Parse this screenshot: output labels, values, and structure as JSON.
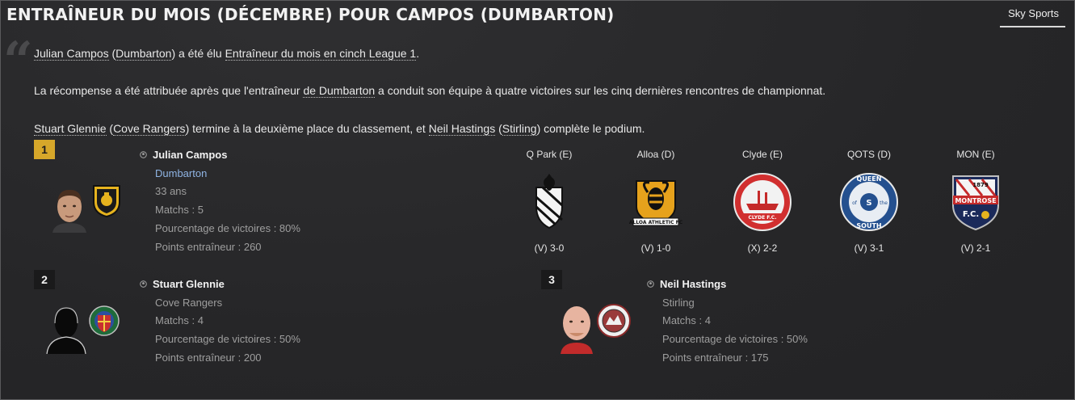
{
  "title": "ENTRAÎNEUR DU MOIS (DÉCEMBRE) POUR CAMPOS (DUMBARTON)",
  "source_tab": "Sky Sports",
  "paragraphs": {
    "p1": {
      "l1": "Julian Campos",
      "t1": " (",
      "l2": "Dumbarton",
      "t2": ") a été élu ",
      "l3": "Entraîneur du mois en cinch League 1",
      "t3": "."
    },
    "p2": {
      "t1": "La récompense a été attribuée après que l'entraîneur ",
      "l1": "de Dumbarton",
      "t2": " a conduit son équipe à quatre victoires sur les cinq dernières rencontres de championnat."
    },
    "p3": {
      "l1": "Stuart Glennie",
      "t1": " (",
      "l2": "Cove Rangers",
      "t2": ") termine à la deuxième place du classement, et ",
      "l3": "Neil Hastings",
      "t3": " (",
      "l4": "Stirling",
      "t4": ") complète le podium."
    }
  },
  "first": {
    "rank": "1",
    "name": "Julian Campos",
    "club": "Dumbarton",
    "age": "33 ans",
    "matches": "Matchs : 5",
    "win_pct": "Pourcentage de victoires : 80%",
    "points": "Points entraîneur : 260"
  },
  "second": {
    "rank": "2",
    "name": "Stuart Glennie",
    "club": "Cove Rangers",
    "matches": "Matchs : 4",
    "win_pct": "Pourcentage de victoires : 50%",
    "points": "Points entraîneur : 200"
  },
  "third": {
    "rank": "3",
    "name": "Neil Hastings",
    "club": "Stirling",
    "matches": "Matchs : 4",
    "win_pct": "Pourcentage de victoires : 50%",
    "points": "Points entraîneur : 175"
  },
  "matches": [
    {
      "opponent": "Q Park (E)",
      "result": "(V) 3-0",
      "badge": "queens-park-crest-icon"
    },
    {
      "opponent": "Alloa (D)",
      "result": "(V) 1-0",
      "badge": "alloa-athletic-crest-icon"
    },
    {
      "opponent": "Clyde (E)",
      "result": "(X) 2-2",
      "badge": "clyde-crest-icon"
    },
    {
      "opponent": "QOTS (D)",
      "result": "(V) 3-1",
      "badge": "queen-of-the-south-crest-icon"
    },
    {
      "opponent": "MON (E)",
      "result": "(V) 2-1",
      "badge": "montrose-crest-icon"
    }
  ],
  "badge_text": {
    "alloa": "ALLOA ATHLETIC FC",
    "clyde": "CLYDE F.C.",
    "qots_top": "QUEEN",
    "qots_of": "of",
    "qots_the": "the",
    "qots_bottom": "SOUTH",
    "mon_year": "1879",
    "mon_name": "MONTROSE",
    "mon_fc": "F.C."
  },
  "colors": {
    "rank_gold": "#d6a72a",
    "club_link": "#8fb4e4"
  }
}
